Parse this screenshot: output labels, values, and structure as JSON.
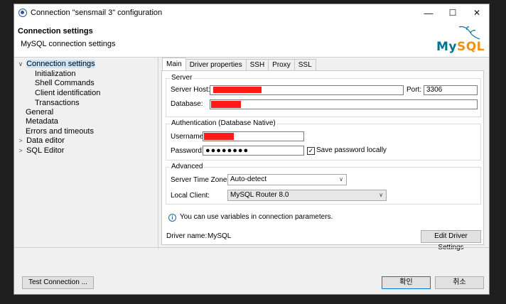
{
  "window": {
    "title": "Connection \"sensmail 3\" configuration",
    "minimize": "—",
    "maximize": "☐",
    "close": "✕"
  },
  "header": {
    "title": "Connection settings",
    "subtitle": "MySQL connection settings",
    "logo_my": "My",
    "logo_sql": "SQL"
  },
  "tree": {
    "items": [
      {
        "label": "Connection settings",
        "chevron": "∨"
      },
      {
        "label": "Initialization"
      },
      {
        "label": "Shell Commands"
      },
      {
        "label": "Client identification"
      },
      {
        "label": "Transactions"
      },
      {
        "label": "General"
      },
      {
        "label": "Metadata"
      },
      {
        "label": "Errors and timeouts"
      },
      {
        "label": "Data editor",
        "chevron": ">"
      },
      {
        "label": "SQL Editor",
        "chevron": ">"
      }
    ]
  },
  "tabs": [
    "Main",
    "Driver properties",
    "SSH",
    "Proxy",
    "SSL"
  ],
  "server": {
    "group_title": "Server",
    "host_label": "Server Host:",
    "port_label": "Port:",
    "port_value": "3306",
    "database_label": "Database:"
  },
  "auth": {
    "group_title": "Authentication (Database Native)",
    "username_label": "Username:",
    "password_label": "Password:",
    "password_value": "●●●●●●●●",
    "save_password_label": "Save password locally",
    "save_password_check": "✓"
  },
  "advanced": {
    "group_title": "Advanced",
    "timezone_label": "Server Time Zone:",
    "timezone_value": "Auto-detect",
    "client_label": "Local Client:",
    "client_value": "MySQL Router 8.0"
  },
  "info": {
    "icon": "i",
    "text": "You can use variables in connection parameters."
  },
  "driver": {
    "label": "Driver name:",
    "value": "MySQL",
    "edit_button": "Edit Driver Settings"
  },
  "footer": {
    "test_button": "Test Connection ...",
    "ok_button": "확인",
    "cancel_button": "취소"
  },
  "colors": {
    "redaction": "#ff1a1a",
    "mysql_blue": "#00758f",
    "mysql_orange": "#f29111",
    "selection": "#cce4f7"
  }
}
